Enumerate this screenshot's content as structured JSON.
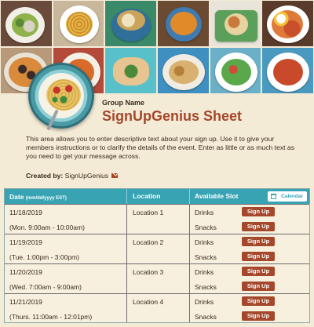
{
  "header": {
    "group_label": "Group Name",
    "title": "SignUpGenius Sheet",
    "description": "This area allows you to enter descriptive text about your sign up. Use it to give your members instructions or to clarify the details of the event. Enter as little or as much text as you need to get your message across.",
    "created_by_label": "Created by:",
    "creator": "SignUpGenius",
    "creator_icon": "mail-icon"
  },
  "colors": {
    "background": "#f4ebd7",
    "accent": "#a4472a",
    "table_header": "#37a3b3"
  },
  "table": {
    "columns": {
      "date": "Date",
      "date_format": "(mm/dd/yyyy EST)",
      "location": "Location",
      "slot": "Available Slot"
    },
    "calendar_button": "Calendar",
    "rows": [
      {
        "date": "11/18/2019",
        "time": "(Mon. 9:00am - 10:00am)",
        "location": "Location 1",
        "slots": [
          {
            "name": "Drinks",
            "action": "Sign Up"
          },
          {
            "name": "Snacks",
            "action": "Sign Up"
          }
        ]
      },
      {
        "date": "11/19/2019",
        "time": "(Tue. 1:00pm - 3:00pm)",
        "location": "Location 2",
        "slots": [
          {
            "name": "Drinks",
            "action": "Sign Up"
          },
          {
            "name": "Snacks",
            "action": "Sign Up"
          }
        ]
      },
      {
        "date": "11/20/2019",
        "time": "(Wed. 7:00am - 9:00am)",
        "location": "Location 3",
        "slots": [
          {
            "name": "Drinks",
            "action": "Sign Up"
          },
          {
            "name": "Snacks",
            "action": "Sign Up"
          }
        ]
      },
      {
        "date": "11/21/2019",
        "time": "(Thurs. 11:00am - 12:01pm)",
        "location": "Location 4",
        "slots": [
          {
            "name": "Drinks",
            "action": "Sign Up"
          },
          {
            "name": "Snacks",
            "action": "Sign Up"
          }
        ]
      }
    ]
  }
}
